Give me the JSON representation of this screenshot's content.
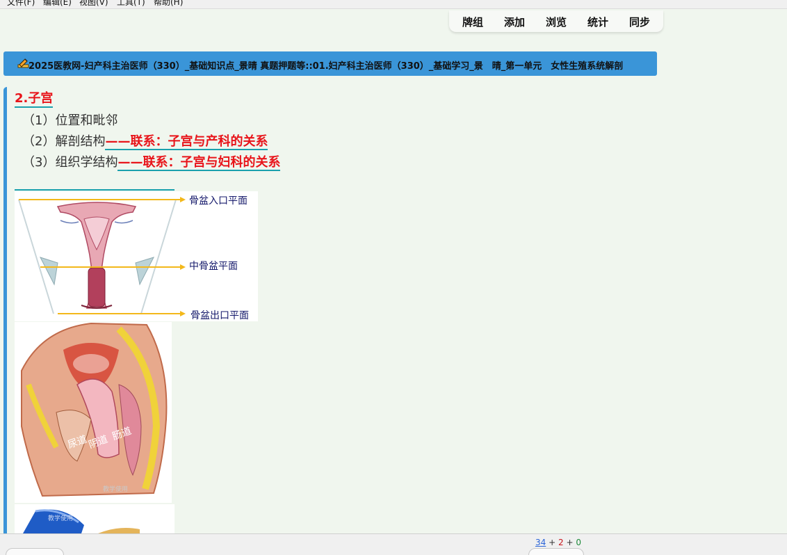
{
  "menu": {
    "items": [
      "文件(F)",
      "编辑(E)",
      "视图(V)",
      "工具(T)",
      "帮助(H)"
    ]
  },
  "toolbar": {
    "buttons": [
      "牌组",
      "添加",
      "浏览",
      "统计",
      "同步"
    ]
  },
  "banner": {
    "breadcrumb": "2025医教网-妇产科主治医师（330）_基础知识点_景晴 真题押题等::01.妇产科主治医师（330）_基础学习_景　晴_第一单元　女性生殖系统解剖"
  },
  "card": {
    "heading": "2.子宫",
    "items": [
      {
        "text": "（1）位置和毗邻",
        "relation": ""
      },
      {
        "text": "（2）解剖结构",
        "relation": "——联系：子宫与产科的关系"
      },
      {
        "text": "（3）组织学结构",
        "relation": "——联系：子宫与妇科的关系"
      }
    ]
  },
  "figure_pelvis": {
    "labels": [
      "骨盆入口平面",
      "中骨盆平面",
      "骨盆出口平面"
    ]
  },
  "figure_sagittal": {
    "labels": [
      "尿道",
      "阴道",
      "肠道"
    ],
    "watermark": "教学使用"
  },
  "figure_third": {
    "watermark": "教学使用"
  },
  "bottom": {
    "new_count": "34",
    "learn_count": "2",
    "review_count": "0",
    "plus": "+"
  },
  "colors": {
    "accent_blue": "#3a95d8",
    "heading_red": "#e8141a",
    "underline_teal": "#1aa0ad",
    "background": "#f0f6ee",
    "arrow_yellow": "#f3b81a"
  },
  "icons": {
    "banner_icon": "edit-pencil-icon"
  }
}
